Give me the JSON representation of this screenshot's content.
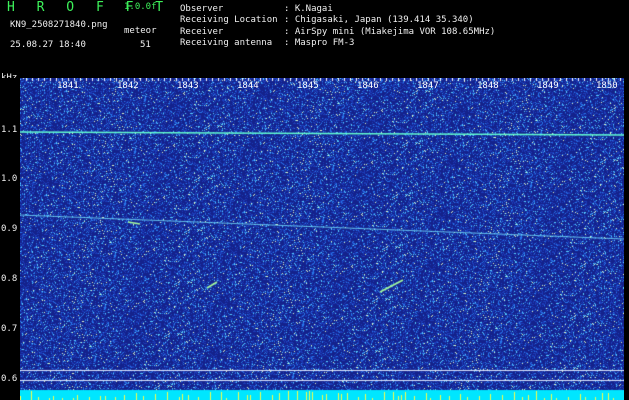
{
  "app": {
    "title": "H R O F F T",
    "version": "1.0.0f",
    "filename": "KN9_2508271840.png",
    "datetime": "25.08.27 18:40",
    "meteor_label": "meteor",
    "meteor_count": "51"
  },
  "info": [
    {
      "key": "Observer",
      "value": ": K.Nagai"
    },
    {
      "key": "Receiving Location",
      "value": ": Chigasaki, Japan (139.414 35.340)"
    },
    {
      "key": "Receiver",
      "value": ": AirSpy mini (Miakejima VOR 108.65MHz)"
    },
    {
      "key": "Receiving antenna",
      "value": ": Maspro FM-3"
    }
  ],
  "axis": {
    "y_unit": "kHz",
    "y_ticks": [
      "1.1",
      "1.0",
      "0.9",
      "0.8",
      "0.7",
      "0.6"
    ],
    "x_ticks": [
      "1841",
      "1842",
      "1843",
      "1844",
      "1845",
      "1846",
      "1847",
      "1848",
      "1849",
      "1850"
    ]
  },
  "colors": {
    "background": "#000000",
    "spectrogram_base": "#16238c",
    "noise_light": "#3fb8ff",
    "signal_line": "#63ffd0",
    "bottom_band": "#00e6ff",
    "title_green": "#3df25a"
  }
}
